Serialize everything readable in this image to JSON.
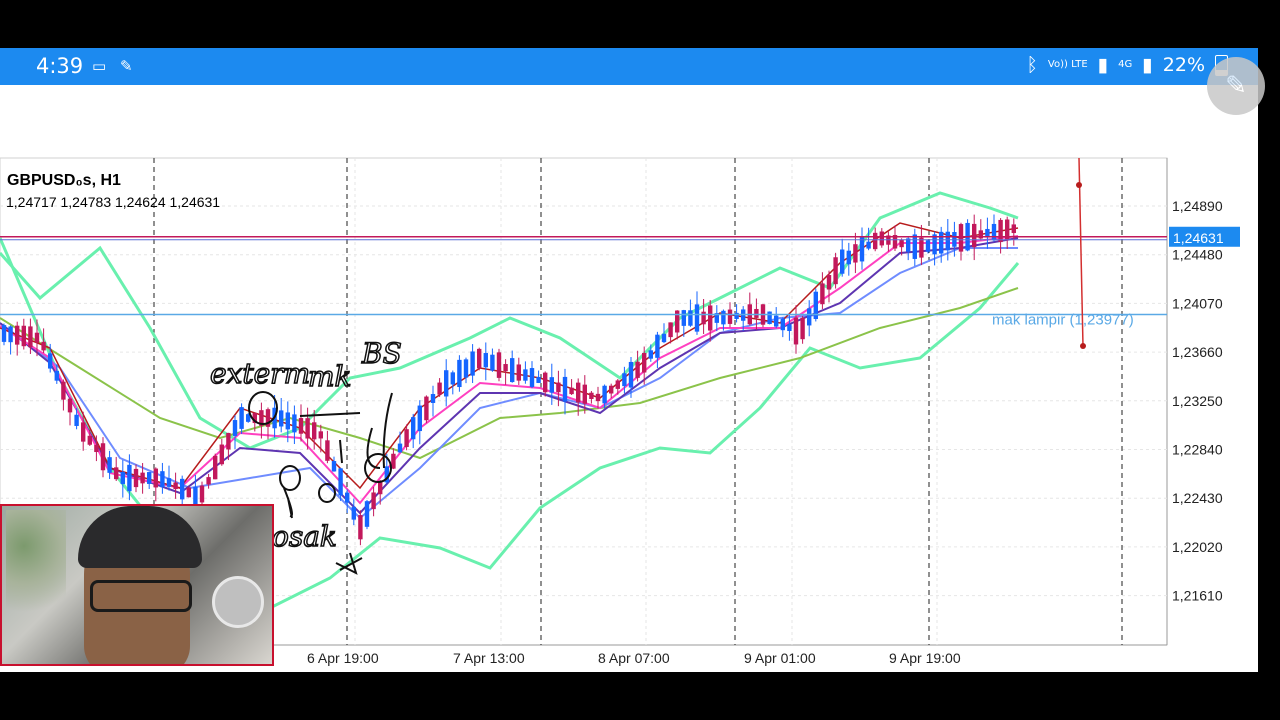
{
  "status_bar": {
    "time": "4:39",
    "battery": "22%",
    "network": "4G",
    "volte": "Vo)) LTE",
    "icons": [
      "cast-icon",
      "pen-icon",
      "bluetooth-icon",
      "signal-icon",
      "battery-icon"
    ]
  },
  "fab": {
    "icon": "pencil-icon"
  },
  "chart_data": {
    "type": "candlestick",
    "symbol": "GBPUSD.s, H1",
    "ohlc": "1.24717 1.24783 1.24624 1.24631",
    "current_price": "1.24631",
    "y_ticks": [
      "1.24890",
      "1.24480",
      "1.24070",
      "1.23660",
      "1.23250",
      "1.22840",
      "1.22430",
      "1.22020",
      "1.21610"
    ],
    "x_ticks": [
      "6 Apr 19:00",
      "7 Apr 13:00",
      "8 Apr 07:00",
      "9 Apr 01:00",
      "9 Apr 19:00"
    ],
    "hline_label": "mak lampir (1.23977)",
    "hline_value": 1.23977,
    "colors": {
      "bull": "#1565ff",
      "bear": "#c2185b",
      "ma_red": "#b71c1c",
      "ma_pink": "#ff40c0",
      "ma_purple": "#5e35b1",
      "ma_blue": "#6f8cff",
      "ma_green": "#8bc34a",
      "bollinger": "#69f0ae",
      "hline": "#5aa9e6",
      "price_line": "#c2185b"
    },
    "annotations": [
      "exterm",
      "mk",
      "BS",
      "osak"
    ]
  },
  "webcam": {
    "label": "webcam-overlay"
  }
}
